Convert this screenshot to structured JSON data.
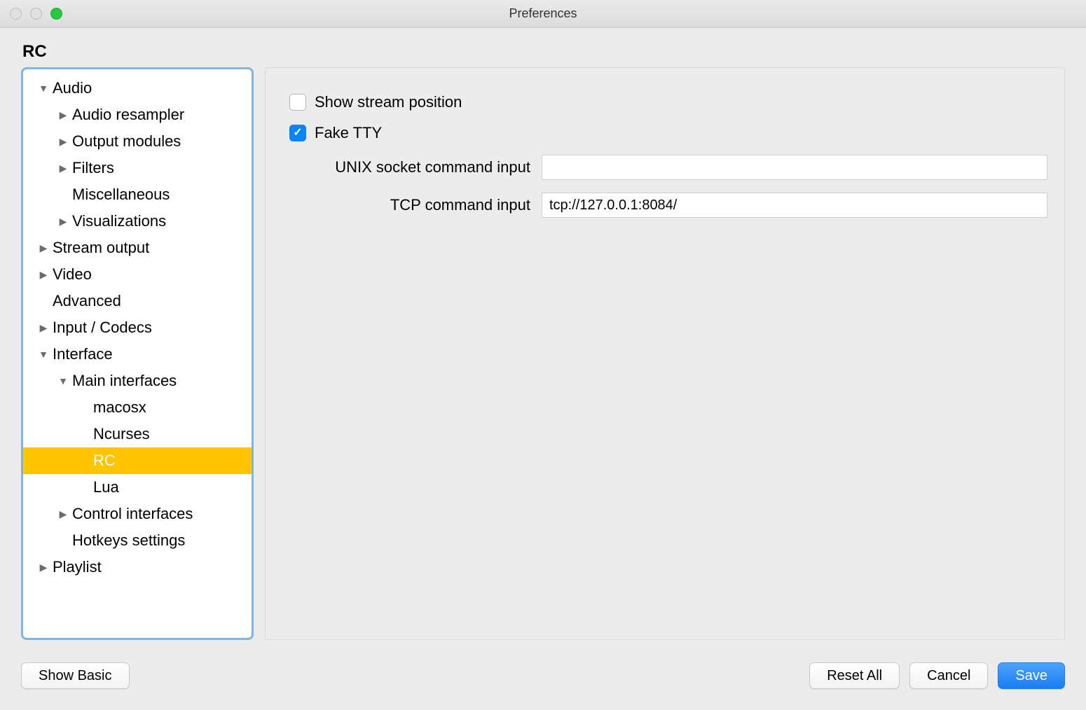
{
  "window": {
    "title": "Preferences"
  },
  "section": {
    "heading": "RC"
  },
  "sidebar": {
    "items": [
      {
        "label": "Audio",
        "expanded": true,
        "level": 0
      },
      {
        "label": "Audio resampler",
        "collapsed": true,
        "level": 1
      },
      {
        "label": "Output modules",
        "collapsed": true,
        "level": 1
      },
      {
        "label": "Filters",
        "collapsed": true,
        "level": 1
      },
      {
        "label": "Miscellaneous",
        "leaf": true,
        "level": 1
      },
      {
        "label": "Visualizations",
        "collapsed": true,
        "level": 1
      },
      {
        "label": "Stream output",
        "collapsed": true,
        "level": 0
      },
      {
        "label": "Video",
        "collapsed": true,
        "level": 0
      },
      {
        "label": "Advanced",
        "leaf": true,
        "level": 0,
        "indent_like_child": true
      },
      {
        "label": "Input / Codecs",
        "collapsed": true,
        "level": 0
      },
      {
        "label": "Interface",
        "expanded": true,
        "level": 0
      },
      {
        "label": "Main interfaces",
        "expanded": true,
        "level": 1
      },
      {
        "label": "macosx",
        "leaf": true,
        "level": 2
      },
      {
        "label": "Ncurses",
        "leaf": true,
        "level": 2
      },
      {
        "label": "RC",
        "leaf": true,
        "level": 2,
        "selected": true
      },
      {
        "label": "Lua",
        "leaf": true,
        "level": 2
      },
      {
        "label": "Control interfaces",
        "collapsed": true,
        "level": 1
      },
      {
        "label": "Hotkeys settings",
        "leaf": true,
        "level": 1
      },
      {
        "label": "Playlist",
        "collapsed": true,
        "level": 0
      }
    ]
  },
  "settings": {
    "show_stream_position": {
      "label": "Show stream position",
      "checked": false
    },
    "fake_tty": {
      "label": "Fake TTY",
      "checked": true
    },
    "unix_socket": {
      "label": "UNIX socket command input",
      "value": ""
    },
    "tcp_input": {
      "label": "TCP command input",
      "value": "tcp://127.0.0.1:8084/"
    }
  },
  "footer": {
    "show_basic": "Show Basic",
    "reset_all": "Reset All",
    "cancel": "Cancel",
    "save": "Save"
  }
}
